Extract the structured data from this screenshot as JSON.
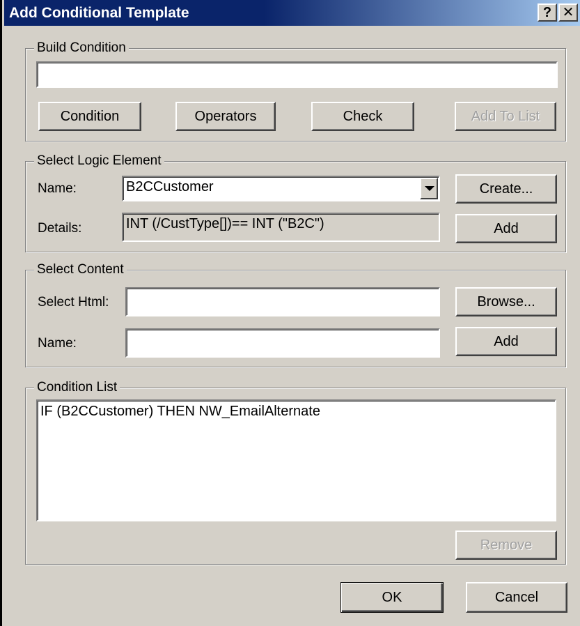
{
  "window": {
    "title": "Add Conditional Template",
    "help_label": "?",
    "close_label": "✕"
  },
  "build_condition": {
    "legend": "Build Condition",
    "input_value": "",
    "buttons": {
      "condition": "Condition",
      "operators": "Operators",
      "check": "Check",
      "add_to_list": "Add To List"
    }
  },
  "select_logic_element": {
    "legend": "Select Logic Element",
    "name_label": "Name:",
    "name_value": "B2CCustomer",
    "details_label": "Details:",
    "details_value": "INT (/CustType[])== INT (\"B2C\")",
    "create_button": "Create...",
    "add_button": "Add"
  },
  "select_content": {
    "legend": "Select Content",
    "html_label": "Select Html:",
    "html_value": "",
    "name_label": "Name:",
    "name_value": "",
    "browse_button": "Browse...",
    "add_button": "Add"
  },
  "condition_list": {
    "legend": "Condition List",
    "items": [
      "IF (B2CCustomer) THEN  NW_EmailAlternate"
    ],
    "remove_button": "Remove"
  },
  "footer": {
    "ok_button": "OK",
    "cancel_button": "Cancel"
  },
  "colors": {
    "title_bar": "#0a246a",
    "dialog_face": "#d4d0c8",
    "disabled_text": "#a0a0a0"
  }
}
